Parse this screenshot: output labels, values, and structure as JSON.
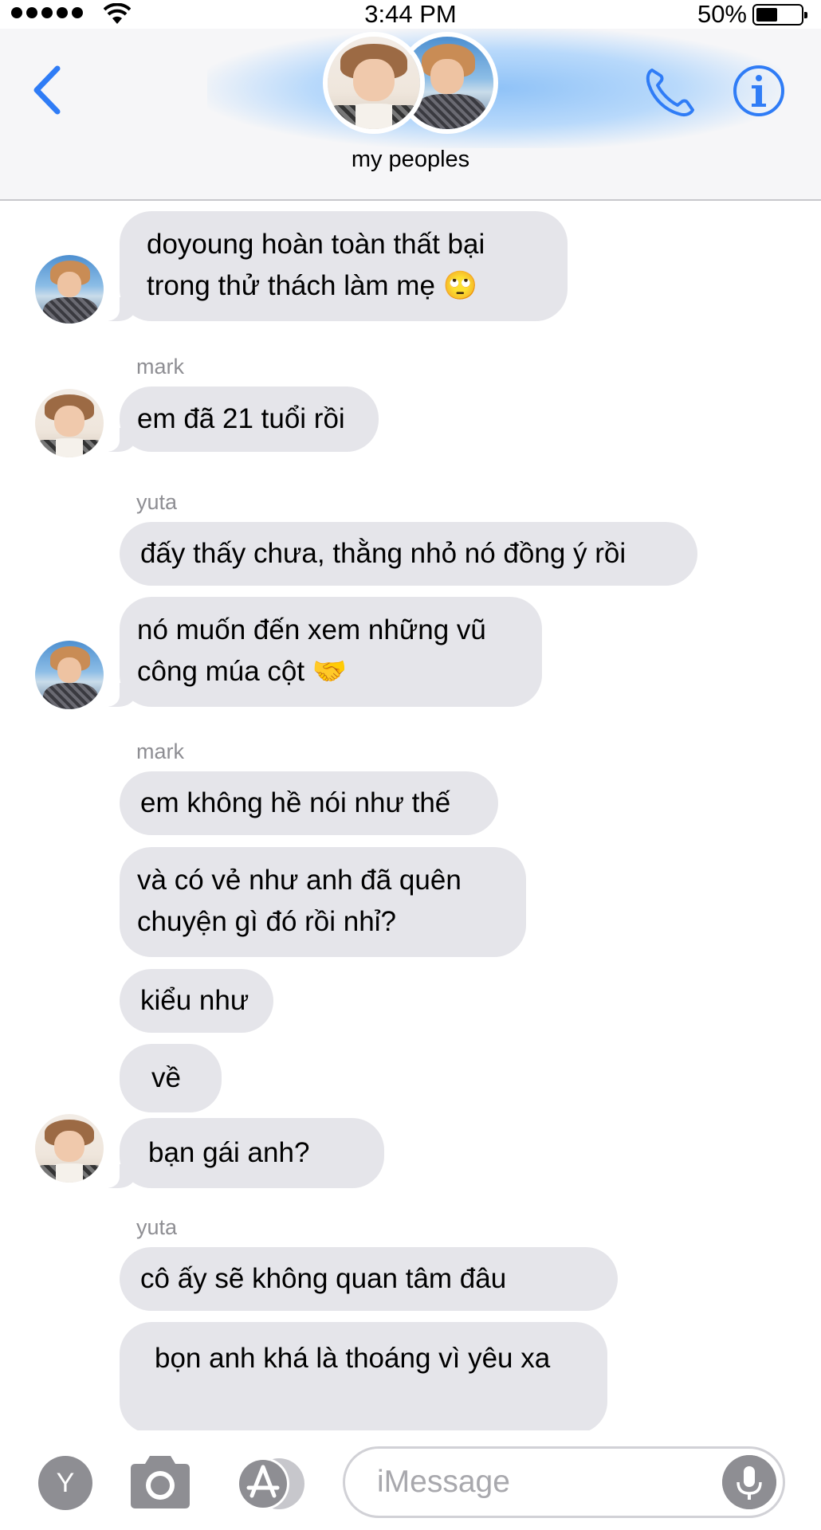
{
  "status_bar": {
    "time": "3:44 PM",
    "battery_pct": "50%",
    "battery_level": 0.5
  },
  "header": {
    "group_name": "my peoples"
  },
  "messages": [
    {
      "sender": "",
      "text": [
        "doyoung hoàn toàn thất bại",
        "trong thử thách làm mẹ 🙄"
      ]
    },
    {
      "sender": "mark",
      "text": [
        "em đã 21 tuổi rồi"
      ]
    },
    {
      "sender": "yuta",
      "text": [
        "đấy thấy chưa, thằng nhỏ nó đồng ý rồi"
      ]
    },
    {
      "sender": "",
      "text": [
        "nó muốn đến xem những vũ",
        "công múa cột 🤝"
      ]
    },
    {
      "sender": "mark",
      "text": [
        "em không hề nói như thế"
      ]
    },
    {
      "sender": "",
      "text": [
        "và có vẻ như anh đã quên",
        "chuyện gì đó rồi nhỉ?"
      ]
    },
    {
      "sender": "",
      "text": [
        "kiểu như"
      ]
    },
    {
      "sender": "",
      "text": [
        "về"
      ]
    },
    {
      "sender": "",
      "text": [
        "bạn gái anh?"
      ]
    },
    {
      "sender": "yuta",
      "text": [
        "cô ấy sẽ không quan tâm đâu"
      ]
    },
    {
      "sender": "",
      "text": [
        "bọn anh khá là thoáng vì yêu xa"
      ]
    }
  ],
  "input": {
    "app_button_label": "Y",
    "placeholder": "iMessage"
  },
  "colors": {
    "accent": "#2f7cf6",
    "bubble_gray": "#e5e5ea",
    "sender_gray": "#8e8e93"
  }
}
